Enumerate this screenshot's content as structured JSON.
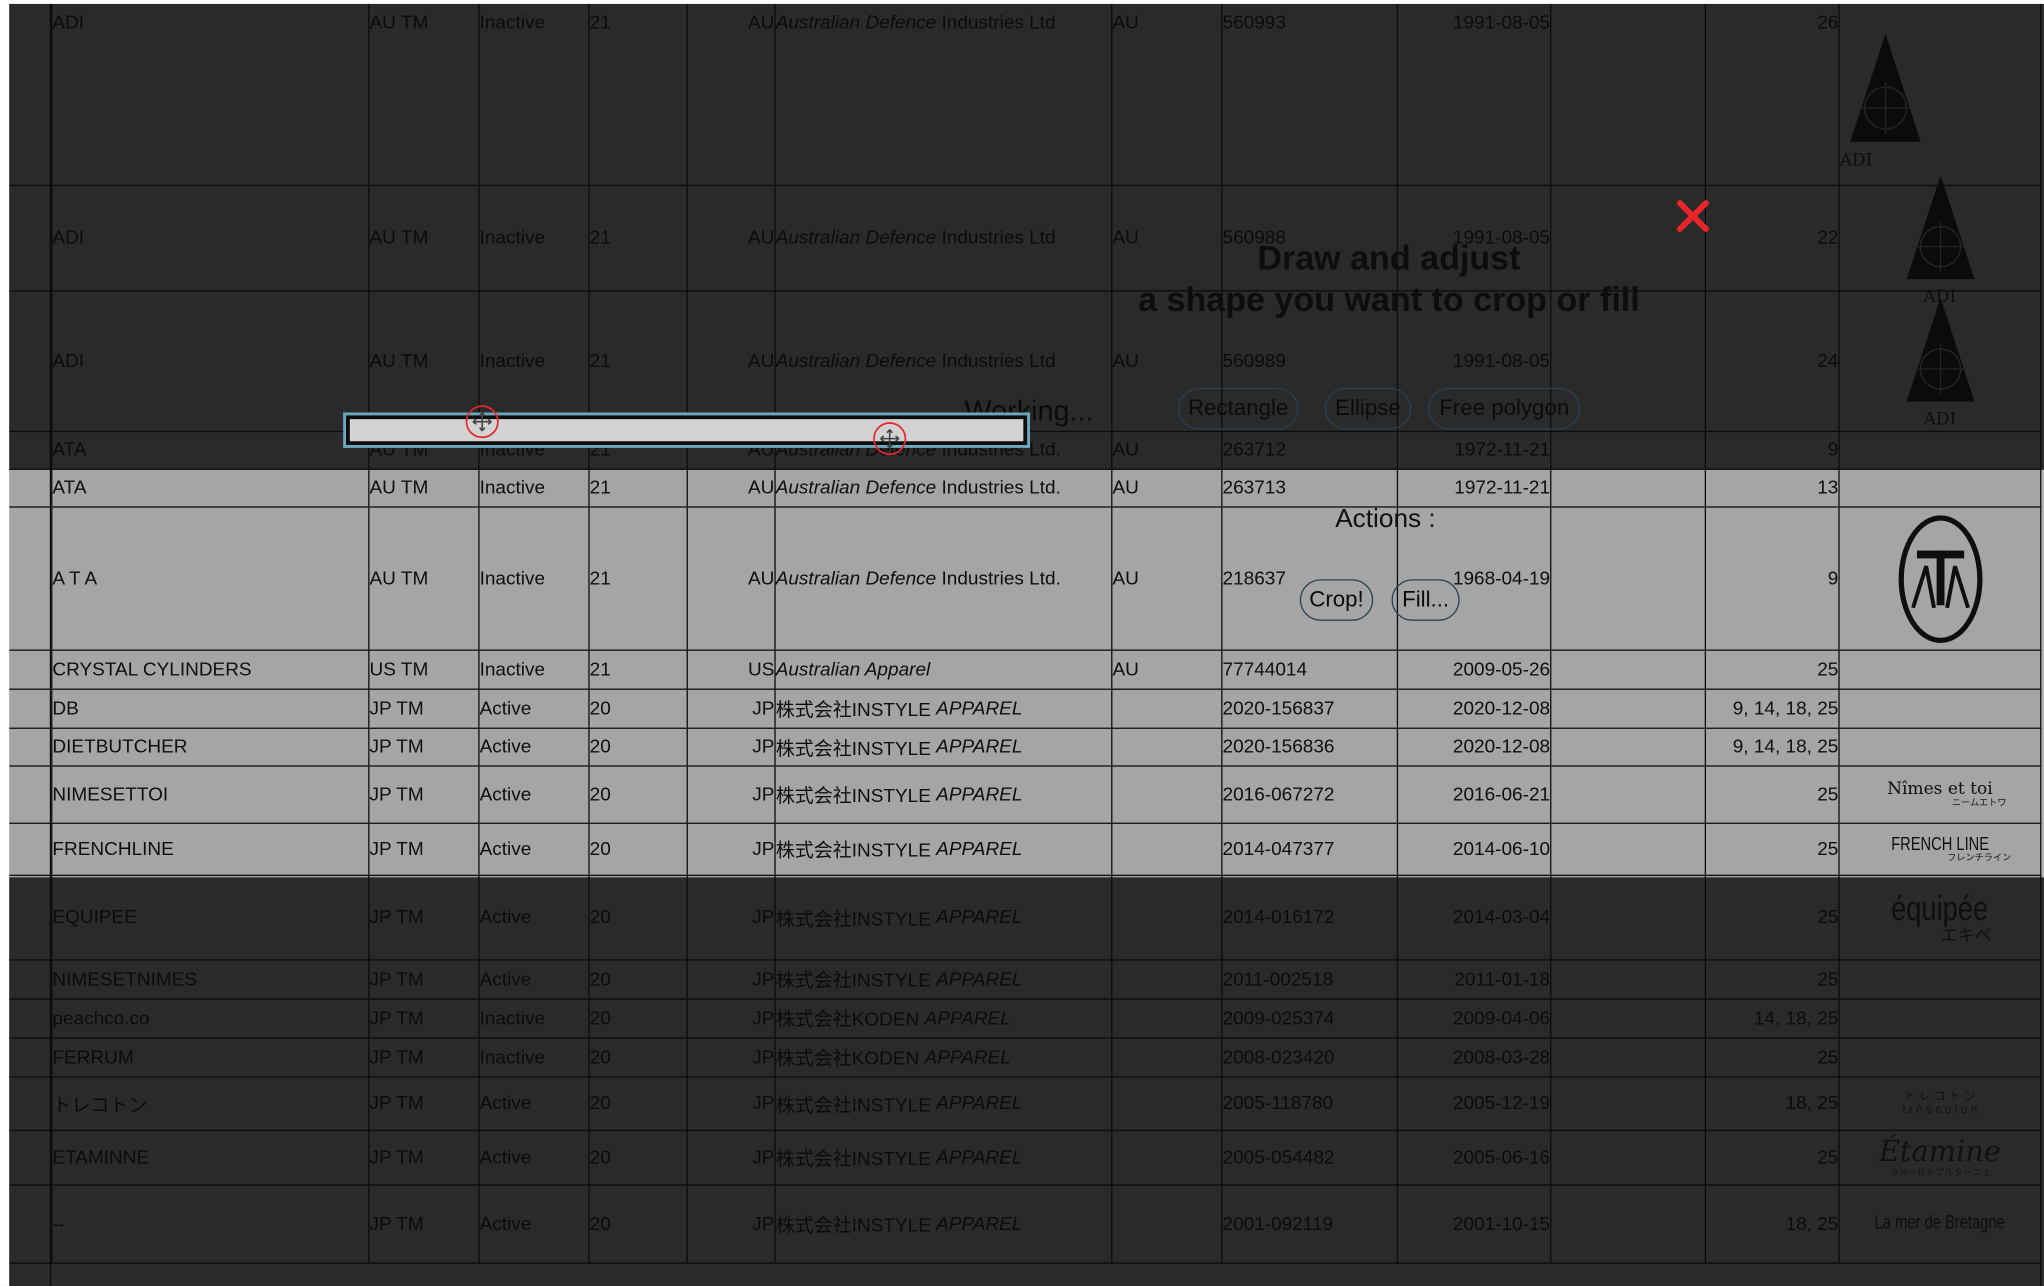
{
  "crop_tool": {
    "title_line1": "Draw and adjust",
    "title_line2": "a shape you want to crop or fill",
    "status": "Working...",
    "shape_buttons": [
      "Rectangle",
      "Ellipse",
      "Free polygon"
    ],
    "actions_label": "Actions :",
    "crop_label": "Crop!",
    "fill_label": "Fill...",
    "close_icon": "close-x-icon",
    "handle_icon": "move-handle-icon",
    "accent_color": "#e8262a"
  },
  "table": {
    "rows": [
      {
        "name": "ADI",
        "type": "AU TM",
        "status": "Inactive",
        "cls": "21",
        "office": "AU",
        "owner_i": "Australian Defence",
        "owner_r": " Industries Ltd",
        "country": "AU",
        "number": "560993",
        "date": "1991-08-05",
        "nice": "26",
        "logo": "ADI"
      },
      {
        "name": "ADI",
        "type": "AU TM",
        "status": "Inactive",
        "cls": "21",
        "office": "AU",
        "owner_i": "Australian Defence",
        "owner_r": " Industries Ltd",
        "country": "AU",
        "number": "560988",
        "date": "1991-08-05",
        "nice": "22",
        "logo": "ADI"
      },
      {
        "name": "ADI",
        "type": "AU TM",
        "status": "Inactive",
        "cls": "21",
        "office": "AU",
        "owner_i": "Australian Defence",
        "owner_r": " Industries Ltd",
        "country": "AU",
        "number": "560989",
        "date": "1991-08-05",
        "nice": "24",
        "logo": "ADI"
      },
      {
        "name": "ATA",
        "type": "AU TM",
        "status": "Inactive",
        "cls": "21",
        "office": "AU",
        "owner_i": "Australian Defence",
        "owner_r": " Industries Ltd.",
        "country": "AU",
        "number": "263712",
        "date": "1972-11-21",
        "nice": "9",
        "logo": ""
      },
      {
        "name": "ATA",
        "type": "AU TM",
        "status": "Inactive",
        "cls": "21",
        "office": "AU",
        "owner_i": "Australian Defence",
        "owner_r": " Industries Ltd.",
        "country": "AU",
        "number": "263713",
        "date": "1972-11-21",
        "nice": "13",
        "logo": ""
      },
      {
        "name": "A T A",
        "type": "AU TM",
        "status": "Inactive",
        "cls": "21",
        "office": "AU",
        "owner_i": "Australian Defence",
        "owner_r": " Industries Ltd.",
        "country": "AU",
        "number": "218637",
        "date": "1968-04-19",
        "nice": "9",
        "logo": "ATA"
      },
      {
        "name": "CRYSTAL CYLINDERS",
        "type": "US TM",
        "status": "Inactive",
        "cls": "21",
        "office": "US",
        "owner_i": "Australian Apparel",
        "owner_r": "",
        "country": "AU",
        "number": "77744014",
        "date": "2009-05-26",
        "nice": "25",
        "logo": ""
      },
      {
        "name": "DB",
        "type": "JP TM",
        "status": "Active",
        "cls": "20",
        "office": "JP",
        "owner_r": "株式会社INSTYLE ",
        "owner_i2": "APPAREL",
        "country": "",
        "number": "2020-156837",
        "date": "2020-12-08",
        "nice": "9, 14, 18, 25",
        "logo": ""
      },
      {
        "name": "DIETBUTCHER",
        "type": "JP TM",
        "status": "Active",
        "cls": "20",
        "office": "JP",
        "owner_r": "株式会社INSTYLE ",
        "owner_i2": "APPAREL",
        "country": "",
        "number": "2020-156836",
        "date": "2020-12-08",
        "nice": "9, 14, 18, 25",
        "logo": ""
      },
      {
        "name": "NIMESETTOI",
        "type": "JP TM",
        "status": "Active",
        "cls": "20",
        "office": "JP",
        "owner_r": "株式会社INSTYLE ",
        "owner_i2": "APPAREL",
        "country": "",
        "number": "2016-067272",
        "date": "2016-06-21",
        "nice": "25",
        "logo": "NIMES"
      },
      {
        "name": "FRENCHLINE",
        "type": "JP TM",
        "status": "Active",
        "cls": "20",
        "office": "JP",
        "owner_r": "株式会社INSTYLE ",
        "owner_i2": "APPAREL",
        "country": "",
        "number": "2014-047377",
        "date": "2014-06-10",
        "nice": "25",
        "logo": "FRENCH"
      },
      {
        "name": "EQUIPEE",
        "type": "JP TM",
        "status": "Active",
        "cls": "20",
        "office": "JP",
        "owner_r": "株式会社INSTYLE ",
        "owner_i2": "APPAREL",
        "country": "",
        "number": "2014-016172",
        "date": "2014-03-04",
        "nice": "25",
        "logo": "EQUIPEE"
      },
      {
        "name": "NIMESETNIMES",
        "type": "JP TM",
        "status": "Active",
        "cls": "20",
        "office": "JP",
        "owner_r": "株式会社INSTYLE ",
        "owner_i2": "APPAREL",
        "country": "",
        "number": "2011-002518",
        "date": "2011-01-18",
        "nice": "25",
        "logo": ""
      },
      {
        "name": "peachco.co",
        "type": "JP TM",
        "status": "Inactive",
        "cls": "20",
        "office": "JP",
        "owner_r": "株式会社KODEN ",
        "owner_i2": "APPAREL",
        "country": "",
        "number": "2009-025374",
        "date": "2009-04-06",
        "nice": "14, 18, 25",
        "logo": ""
      },
      {
        "name": "FERRUM",
        "type": "JP TM",
        "status": "Inactive",
        "cls": "20",
        "office": "JP",
        "owner_r": "株式会社KODEN ",
        "owner_i2": "APPAREL",
        "country": "",
        "number": "2008-023420",
        "date": "2008-03-28",
        "nice": "25",
        "logo": ""
      },
      {
        "name": "トレコトン",
        "type": "JP TM",
        "status": "Active",
        "cls": "20",
        "office": "JP",
        "owner_r": "株式会社INSTYLE ",
        "owner_i2": "APPAREL",
        "country": "",
        "number": "2005-118780",
        "date": "2005-12-19",
        "nice": "18, 25",
        "logo": "TRES"
      },
      {
        "name": "ETAMINNE",
        "type": "JP TM",
        "status": "Active",
        "cls": "20",
        "office": "JP",
        "owner_r": "株式会社INSTYLE ",
        "owner_i2": "APPAREL",
        "country": "",
        "number": "2005-054482",
        "date": "2005-06-16",
        "nice": "25",
        "logo": "ETAMINE"
      },
      {
        "name": "--",
        "type": "JP TM",
        "status": "Active",
        "cls": "20",
        "office": "JP",
        "owner_r": "株式会社INSTYLE ",
        "owner_i2": "APPAREL",
        "country": "",
        "number": "2001-092119",
        "date": "2001-10-15",
        "nice": "18, 25",
        "logo": "MER"
      }
    ],
    "logo_text": {
      "ADI": "ADI",
      "ATA": "ATA",
      "NIMES_1": "Nîmes et toi",
      "NIMES_2": "ニームエトワ",
      "FRENCH_1": "FRENCH LINE",
      "FRENCH_2": "フレンチライン",
      "EQUIPEE_1": "équipée",
      "EQUIPEE_2": "エキペ",
      "TRES_1": "ト レ コ ト ン",
      "TRES_2": "t r è s  c o t o n",
      "ETAMINE_1": "Étamine",
      "ETAMINE_2": "ラメールドブルターニュ",
      "MER_1": "La mer de Bretagne"
    }
  }
}
